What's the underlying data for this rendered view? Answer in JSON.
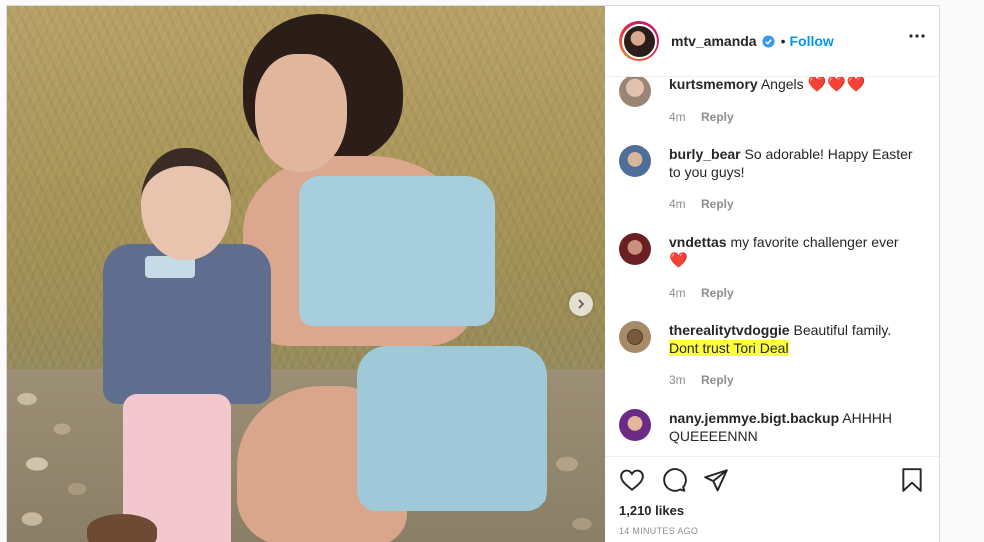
{
  "post": {
    "username": "mtv_amanda",
    "dot": "•",
    "follow_label": "Follow",
    "likes": "1,210 likes",
    "timestamp": "14 MINUTES AGO"
  },
  "icons": {
    "verified": "verified-badge-icon",
    "more": "more-options-icon",
    "next": "chevron-right-icon",
    "like": "heart-icon",
    "comment": "comment-bubble-icon",
    "share": "paper-plane-icon",
    "save": "bookmark-icon"
  },
  "colors": {
    "accent": "#0095f6",
    "highlight": "#ffff3c",
    "heart": "#ed4956"
  },
  "comments": [
    {
      "user": "kurtsmemory",
      "text": "Angels",
      "hearts": "❤️❤️❤️",
      "time": "4m",
      "reply": "Reply"
    },
    {
      "user": "burly_bear",
      "text": "So adorable! Happy Easter to you guys!",
      "time": "4m",
      "reply": "Reply"
    },
    {
      "user": "vndettas",
      "text": "my favorite challenger ever",
      "hearts": "❤️",
      "time": "4m",
      "reply": "Reply"
    },
    {
      "user": "therealitytvdoggie",
      "text": "Beautiful family.",
      "highlight": "Dont trust Tori Deal",
      "time": "3m",
      "reply": "Reply"
    },
    {
      "user": "nany.jemmye.bigt.backup",
      "text": "AHHHH QUEEEENNN"
    }
  ]
}
